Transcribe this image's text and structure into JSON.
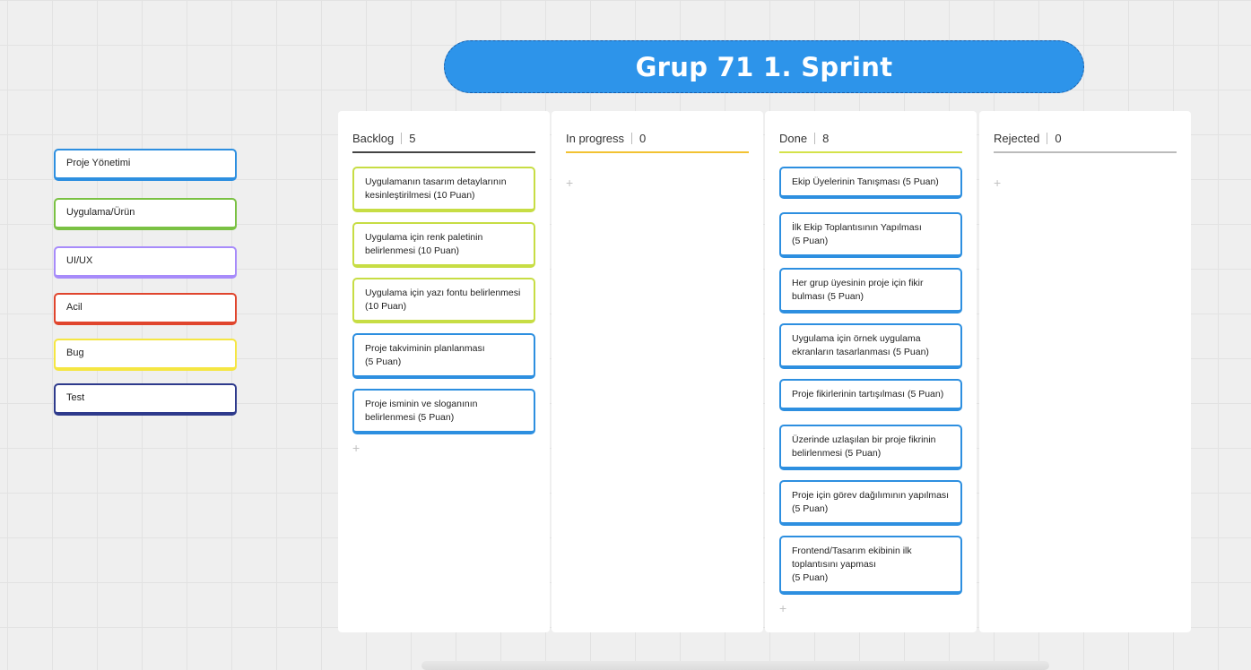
{
  "board": {
    "title": "Grup 71 1. Sprint"
  },
  "legend": [
    {
      "label": "Proje Yönetimi",
      "color": "#2d8fe0"
    },
    {
      "label": "Uygulama/Ürün",
      "color": "#7ac143"
    },
    {
      "label": "UI/UX",
      "color": "#a78bfa"
    },
    {
      "label": "Acil",
      "color": "#e0452d"
    },
    {
      "label": "Bug",
      "color": "#f5e642"
    },
    {
      "label": "Test",
      "color": "#2e3a8c"
    }
  ],
  "columns": [
    {
      "title": "Backlog",
      "count": "5",
      "line_color": "#444444",
      "cards": [
        {
          "text": "Uygulamanın tasarım detaylarının kesinleştirilmesi (10 Puan)",
          "color": "green"
        },
        {
          "text": "Uygulama için renk paletinin belirlenmesi (10 Puan)",
          "color": "green"
        },
        {
          "text": "Uygulama için yazı fontu belirlenmesi (10 Puan)",
          "color": "green"
        },
        {
          "text": "Proje takviminin planlanması\n(5 Puan)",
          "color": "blue"
        },
        {
          "text": "Proje isminin ve sloganının belirlenmesi (5 Puan)",
          "color": "blue"
        }
      ]
    },
    {
      "title": "In progress",
      "count": "0",
      "line_color": "#f2c232",
      "cards": []
    },
    {
      "title": "Done",
      "count": "8",
      "line_color": "#d4e24a",
      "cards": [
        {
          "text": "Ekip Üyelerinin Tanışması (5 Puan)",
          "color": "blue"
        },
        {
          "text": "İlk Ekip Toplantısının Yapılması\n(5 Puan)",
          "color": "blue"
        },
        {
          "text": "Her grup üyesinin proje için fikir bulması (5 Puan)",
          "color": "blue"
        },
        {
          "text": "Uygulama için örnek uygulama ekranların tasarlanması (5 Puan)",
          "color": "blue"
        },
        {
          "text": "Proje fikirlerinin tartışılması (5 Puan)",
          "color": "blue"
        },
        {
          "text": "Üzerinde uzlaşılan bir proje fikrinin belirlenmesi (5 Puan)",
          "color": "blue"
        },
        {
          "text": "Proje için görev dağılımının yapılması\n(5 Puan)",
          "color": "blue"
        },
        {
          "text": "Frontend/Tasarım ekibinin ilk toplantısını yapması\n(5 Puan)",
          "color": "blue"
        }
      ]
    },
    {
      "title": "Rejected",
      "count": "0",
      "line_color": "#bbbbbb",
      "cards": []
    }
  ],
  "add_symbol": "+"
}
